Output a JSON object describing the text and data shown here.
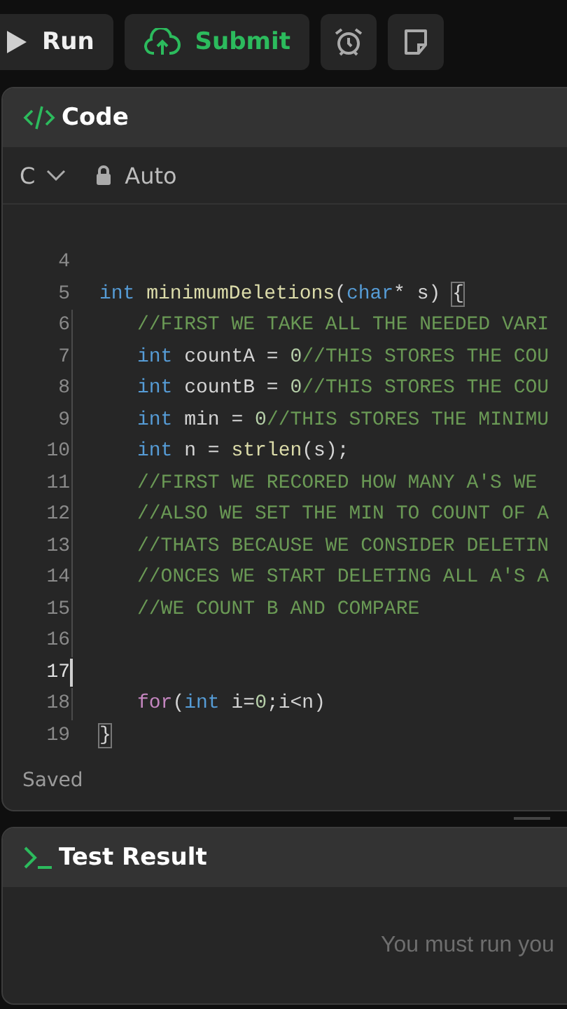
{
  "toolbar": {
    "run": "Run",
    "submit": "Submit"
  },
  "code_panel": {
    "title": "Code",
    "language": "C",
    "mode": "Auto",
    "status": "Saved",
    "lines": [
      {
        "number": "4",
        "active": false
      },
      {
        "number": "5",
        "active": false,
        "tokens": [
          {
            "kind": "keyword",
            "text": "int "
          },
          {
            "kind": "function",
            "text": "minimumDeletions"
          },
          {
            "kind": "plain",
            "text": "("
          },
          {
            "kind": "keyword",
            "text": "char"
          },
          {
            "kind": "plain",
            "text": "* s) "
          },
          {
            "kind": "bracket",
            "text": "{"
          }
        ],
        "children": [
          {
            "number": "6",
            "active": false,
            "tokens": [
              {
                "kind": "comment",
                "text": "//FIRST WE TAKE ALL THE NEEDED VARI"
              }
            ]
          },
          {
            "number": "7",
            "active": false,
            "tokens": [
              {
                "kind": "keyword",
                "text": "int"
              },
              {
                "kind": "plain",
                "text": " countA = "
              },
              {
                "kind": "number",
                "text": "0"
              },
              {
                "kind": "comment",
                "text": "//THIS STORES THE COU"
              }
            ]
          },
          {
            "number": "8",
            "active": false,
            "tokens": [
              {
                "kind": "keyword",
                "text": "int"
              },
              {
                "kind": "plain",
                "text": " countB = "
              },
              {
                "kind": "number",
                "text": "0"
              },
              {
                "kind": "comment",
                "text": "//THIS STORES THE COU"
              }
            ]
          },
          {
            "number": "9",
            "active": false,
            "tokens": [
              {
                "kind": "keyword",
                "text": "int"
              },
              {
                "kind": "plain",
                "text": " min = "
              },
              {
                "kind": "number",
                "text": "0"
              },
              {
                "kind": "comment",
                "text": "//THIS STORES THE MINIMU"
              }
            ]
          },
          {
            "number": "10",
            "active": false,
            "tokens": [
              {
                "kind": "keyword",
                "text": "int"
              },
              {
                "kind": "plain",
                "text": " n = "
              },
              {
                "kind": "function",
                "text": "strlen"
              },
              {
                "kind": "plain",
                "text": "(s);"
              }
            ]
          },
          {
            "number": "11",
            "active": false,
            "tokens": [
              {
                "kind": "comment",
                "text": "//FIRST WE RECORED HOW MANY A'S WE"
              }
            ]
          },
          {
            "number": "12",
            "active": false,
            "tokens": [
              {
                "kind": "comment",
                "text": "//ALSO WE SET THE MIN TO COUNT OF A"
              }
            ]
          },
          {
            "number": "13",
            "active": false,
            "tokens": [
              {
                "kind": "comment",
                "text": "//THATS BECAUSE WE CONSIDER DELETIN"
              }
            ]
          },
          {
            "number": "14",
            "active": false,
            "tokens": [
              {
                "kind": "comment",
                "text": "//ONCES WE START DELETING ALL A'S A"
              }
            ]
          },
          {
            "number": "15",
            "active": false,
            "tokens": [
              {
                "kind": "comment",
                "text": "//WE COUNT B AND COMPARE"
              }
            ]
          },
          {
            "number": "16",
            "active": false
          },
          {
            "number": "17",
            "active": true
          },
          {
            "number": "18",
            "active": false,
            "tokens": [
              {
                "kind": "control",
                "text": "for"
              },
              {
                "kind": "plain",
                "text": "("
              },
              {
                "kind": "keyword",
                "text": "int"
              },
              {
                "kind": "plain",
                "text": " i="
              },
              {
                "kind": "number",
                "text": "0"
              },
              {
                "kind": "plain",
                "text": ";i<n)"
              }
            ]
          }
        ]
      },
      {
        "number": "19",
        "active": false,
        "tokens": [
          {
            "kind": "bracket",
            "text": "}"
          }
        ]
      }
    ]
  },
  "test_panel": {
    "title": "Test Result",
    "message": "You must run you"
  }
}
